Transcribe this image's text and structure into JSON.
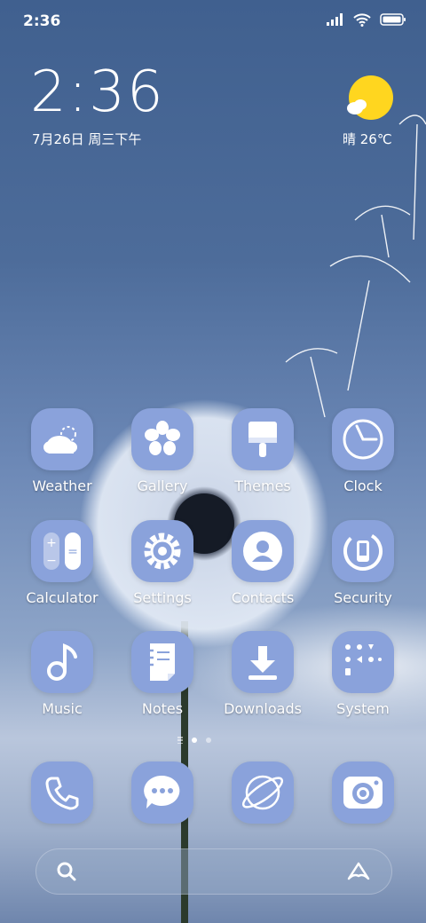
{
  "status_bar": {
    "time": "2:36",
    "icons": [
      "signal-icon",
      "wifi-icon",
      "battery-icon"
    ]
  },
  "clock_widget": {
    "time": "2:36",
    "date": "7月26日 周三下午"
  },
  "weather_widget": {
    "icon": "sun-cloud-icon",
    "text": "晴 26℃"
  },
  "apps": [
    {
      "label": "Weather",
      "icon": "weather-icon"
    },
    {
      "label": "Gallery",
      "icon": "gallery-flower-icon"
    },
    {
      "label": "Themes",
      "icon": "paint-brush-icon"
    },
    {
      "label": "Clock",
      "icon": "clock-icon"
    },
    {
      "label": "Calculator",
      "icon": "calculator-icon"
    },
    {
      "label": "Settings",
      "icon": "gear-icon"
    },
    {
      "label": "Contacts",
      "icon": "contact-person-icon"
    },
    {
      "label": "Security",
      "icon": "security-icon"
    },
    {
      "label": "Music",
      "icon": "music-note-icon"
    },
    {
      "label": "Notes",
      "icon": "notes-icon"
    },
    {
      "label": "Downloads",
      "icon": "download-icon"
    },
    {
      "label": "System",
      "icon": "system-tools-icon"
    }
  ],
  "pages": {
    "count": 3,
    "active_index": 1
  },
  "dock": [
    {
      "icon": "phone-icon"
    },
    {
      "icon": "message-icon"
    },
    {
      "icon": "browser-planet-icon"
    },
    {
      "icon": "camera-icon"
    }
  ],
  "search_bar": {
    "left_icon": "search-icon",
    "right_icon": "assistant-icon"
  },
  "colors": {
    "icon_bg": "#8aa2db",
    "icon_fg": "#ffffff",
    "sun": "#ffd61f"
  }
}
